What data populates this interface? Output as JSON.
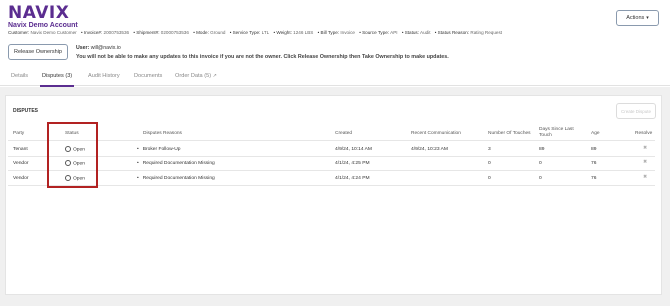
{
  "header": {
    "logo": "NAVIX",
    "account_name": "Navix Demo Account",
    "meta": [
      {
        "label": "Customer:",
        "value": "Navix Demo Customer"
      },
      {
        "label": "• Invoice#:",
        "value": "2000753536"
      },
      {
        "label": "• Shipment#:",
        "value": "02000753536"
      },
      {
        "label": "• Mode:",
        "value": "Ground"
      },
      {
        "label": "• Service Type:",
        "value": "LTL"
      },
      {
        "label": "• Weight:",
        "value": "1246 LBS"
      },
      {
        "label": "• Bill Type:",
        "value": "Invoice"
      },
      {
        "label": "• Source Type:",
        "value": "API"
      },
      {
        "label": "• Status:",
        "value": "Audit"
      },
      {
        "label": "• Status Reason:",
        "value": "Rating Request"
      }
    ],
    "actions_label": "Actions"
  },
  "ownership": {
    "release_label": "Release Ownership",
    "user_label": "User:",
    "user_email": "will@navix.io",
    "warning": "You will not be able to make any updates to this invoice if you are not the owner. Click Release Ownership then Take Ownership to make updates."
  },
  "tabs": [
    {
      "label": "Details",
      "active": false
    },
    {
      "label": "Disputes",
      "count": "(3)",
      "active": true
    },
    {
      "label": "Audit History",
      "active": false
    },
    {
      "label": "Documents",
      "active": false
    },
    {
      "label": "Order Data",
      "count": "(5)",
      "active": false
    }
  ],
  "disputes": {
    "title": "DISPUTES",
    "create_label": "Create Dispute",
    "columns": [
      "Party",
      "Status",
      "Disputes Reasons",
      "Created",
      "Recent Communication",
      "Number Of Touches",
      "Days Since Last Touch",
      "Age",
      "Resolve"
    ],
    "rows": [
      {
        "party": "Tenant",
        "status": "Open",
        "reason": "Broker Follow-Up",
        "created": "4/9/24, 10:14 AM",
        "recent": "4/9/24, 10:23 AM",
        "touches": "3",
        "days_since": "89",
        "age": "89"
      },
      {
        "party": "Vendor",
        "status": "Open",
        "reason": "Required Documentation Missing",
        "created": "4/1/24, 4:25 PM",
        "recent": "",
        "touches": "0",
        "days_since": "0",
        "age": "76"
      },
      {
        "party": "Vendor",
        "status": "Open",
        "reason": "Required Documentation Missing",
        "created": "4/1/24, 4:24 PM",
        "recent": "",
        "touches": "0",
        "days_since": "0",
        "age": "76"
      }
    ]
  },
  "icons": {
    "radio": "radio-circle-icon",
    "resolve": "resolve-icon",
    "external": "external-link-icon",
    "chevron": "chevron-down-icon"
  },
  "colors": {
    "brand": "#5b2d90",
    "highlight": "#b22222"
  }
}
